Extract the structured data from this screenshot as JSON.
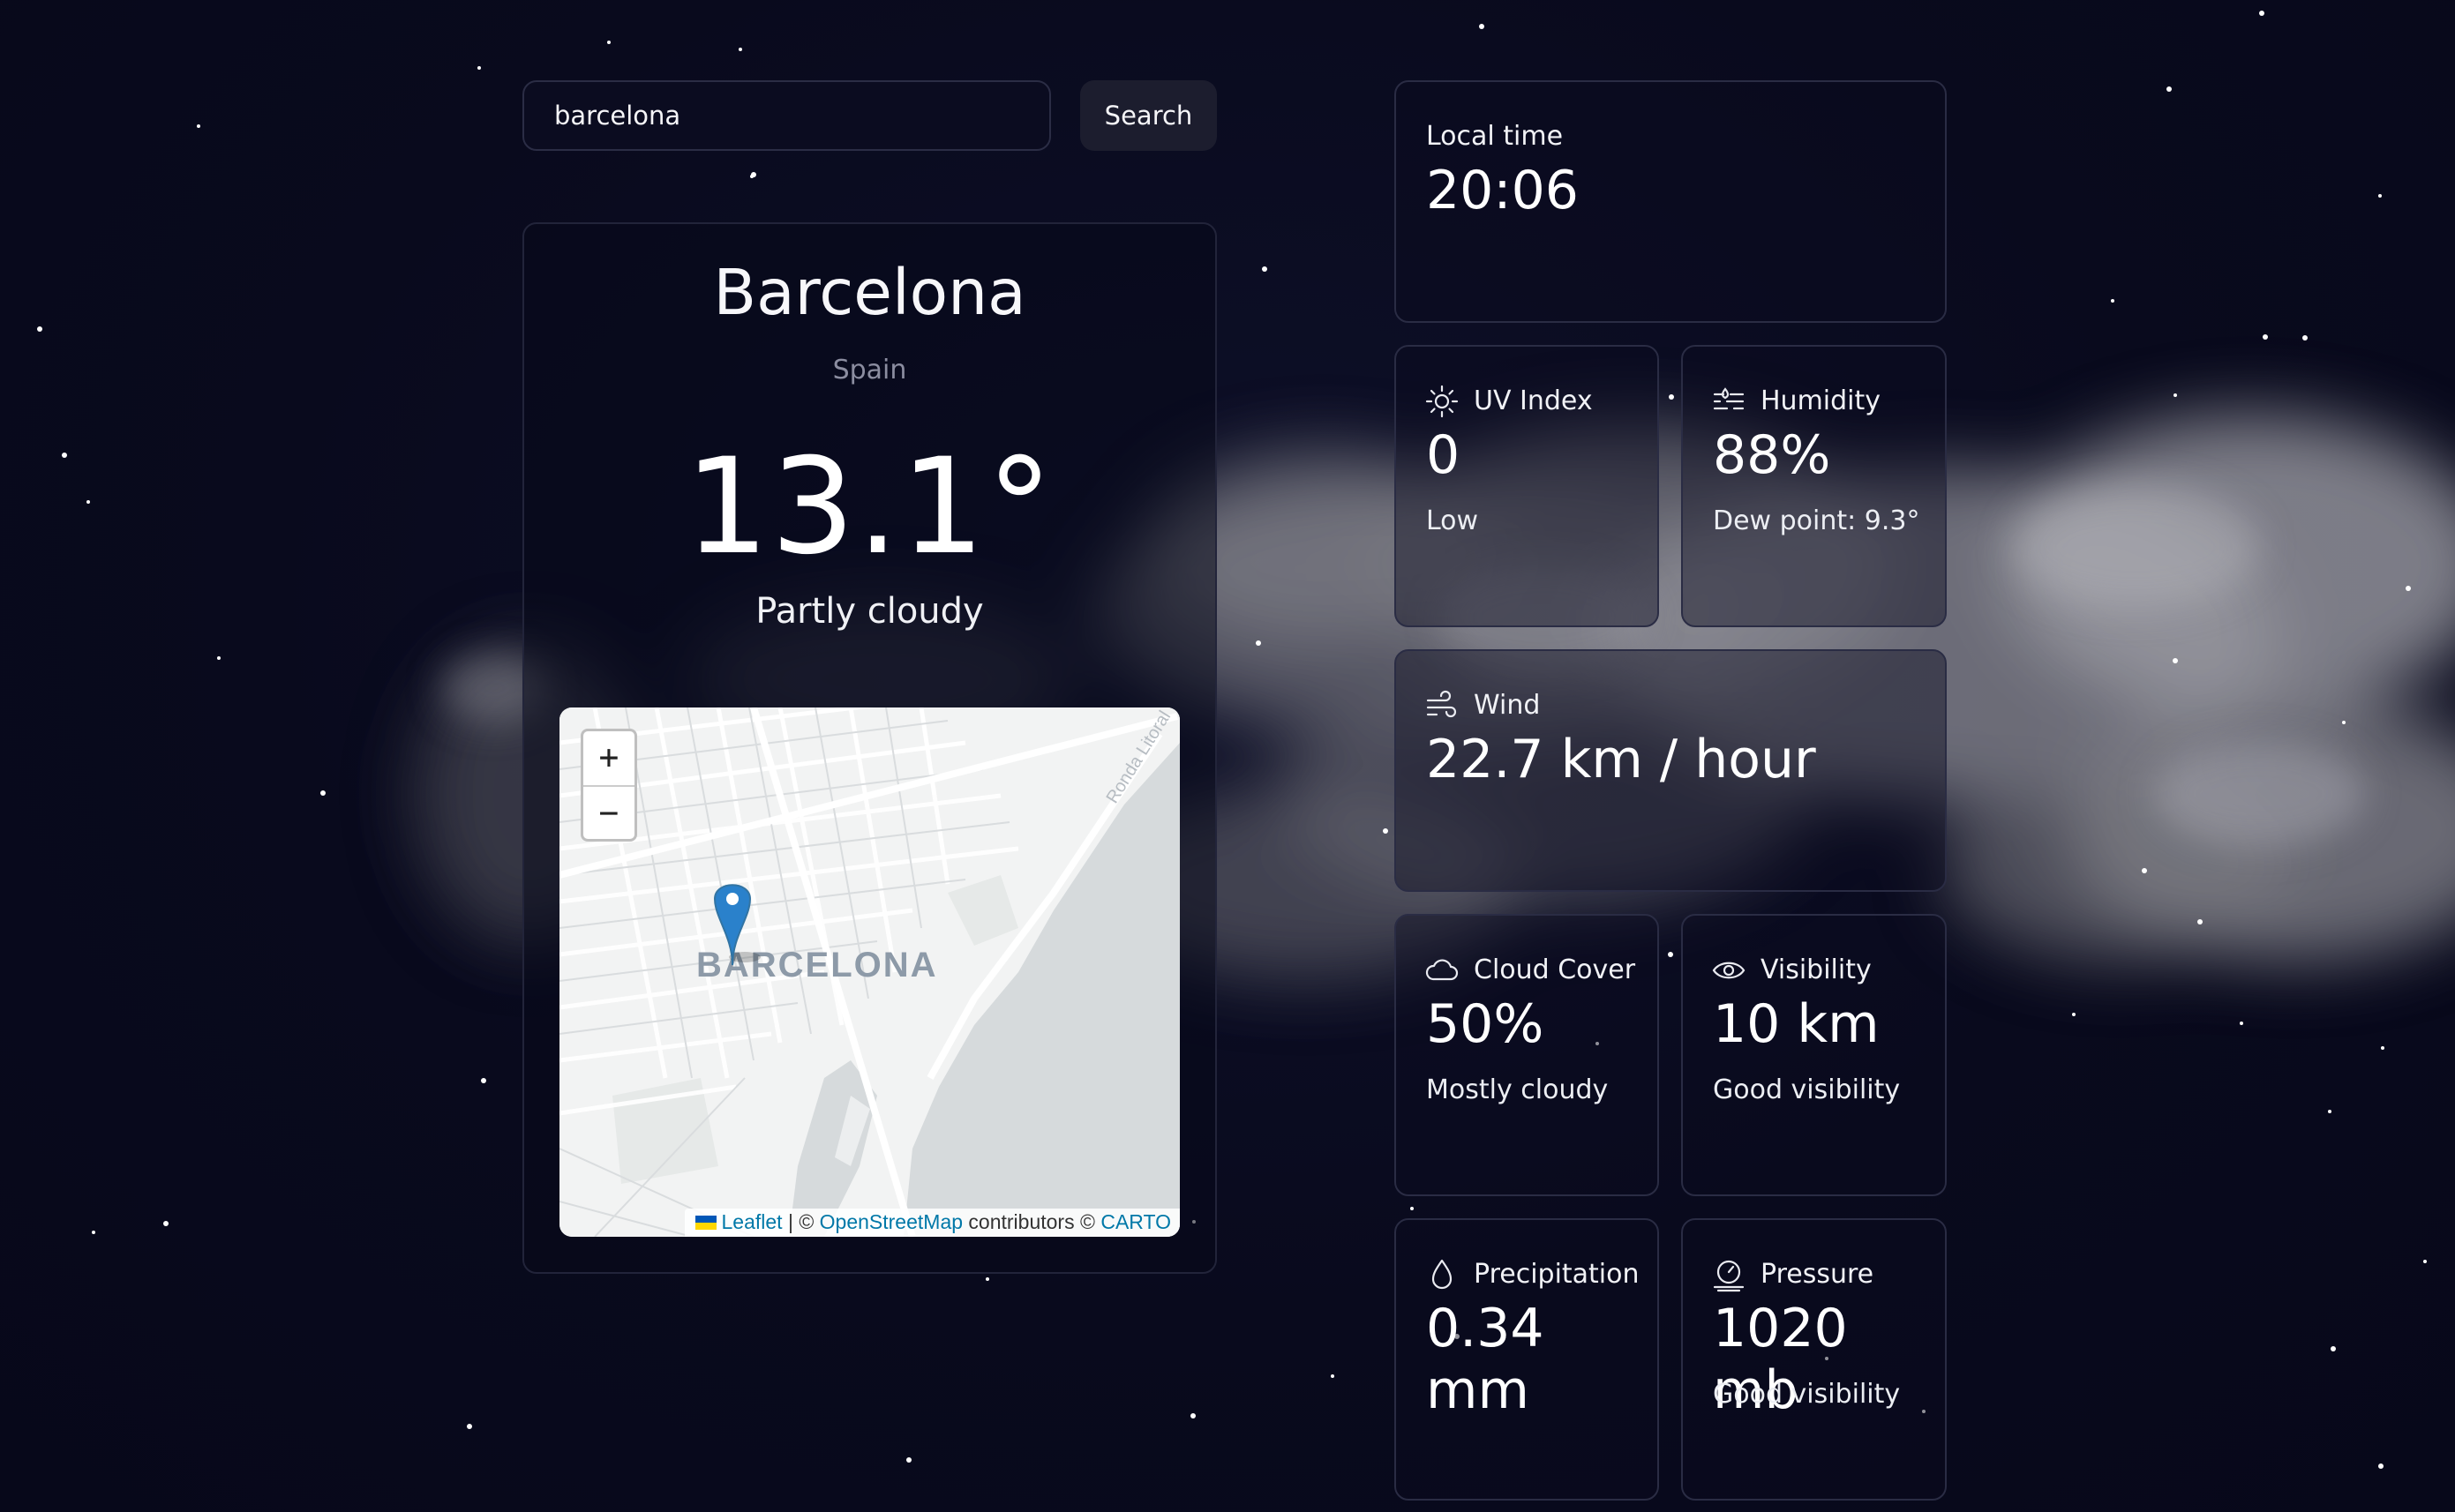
{
  "search": {
    "value": "barcelona",
    "button_label": "Search"
  },
  "location": {
    "city": "Barcelona",
    "country": "Spain",
    "temperature": "13.1°",
    "condition": "Partly cloudy"
  },
  "map": {
    "city_label": "BARCELONA",
    "street_label": "Ronda Litoral",
    "zoom_in": "+",
    "zoom_out": "−",
    "attribution": {
      "leaflet": "Leaflet",
      "sep": " | © ",
      "osm": "OpenStreetMap",
      "contributors": " contributors © ",
      "carto": "CARTO"
    }
  },
  "tiles": {
    "local_time": {
      "title": "Local time",
      "value": "20:06"
    },
    "uv": {
      "title": "UV Index",
      "value": "0",
      "sub": "Low",
      "icon": "sun-icon"
    },
    "humidity": {
      "title": "Humidity",
      "value": "88%",
      "sub": "Dew point: 9.3°",
      "icon": "humidity-icon"
    },
    "wind": {
      "title": "Wind",
      "value": "22.7 km / hour",
      "icon": "wind-icon"
    },
    "cloud_cover": {
      "title": "Cloud Cover",
      "value": "50%",
      "sub": "Mostly cloudy",
      "icon": "cloud-icon"
    },
    "visibility": {
      "title": "Visibility",
      "value": "10 km",
      "sub": "Good visibility",
      "icon": "eye-icon"
    },
    "precipitation": {
      "title": "Precipitation",
      "value": "0.34 mm",
      "icon": "droplet-icon"
    },
    "pressure": {
      "title": "Pressure",
      "value": "1020 mb",
      "sub": "Good visibility",
      "icon": "gauge-icon"
    }
  },
  "colors": {
    "background": "#090a1d",
    "tile_border": "#2a2c44",
    "map_marker": "#2a81cb",
    "link": "#0078a8"
  }
}
